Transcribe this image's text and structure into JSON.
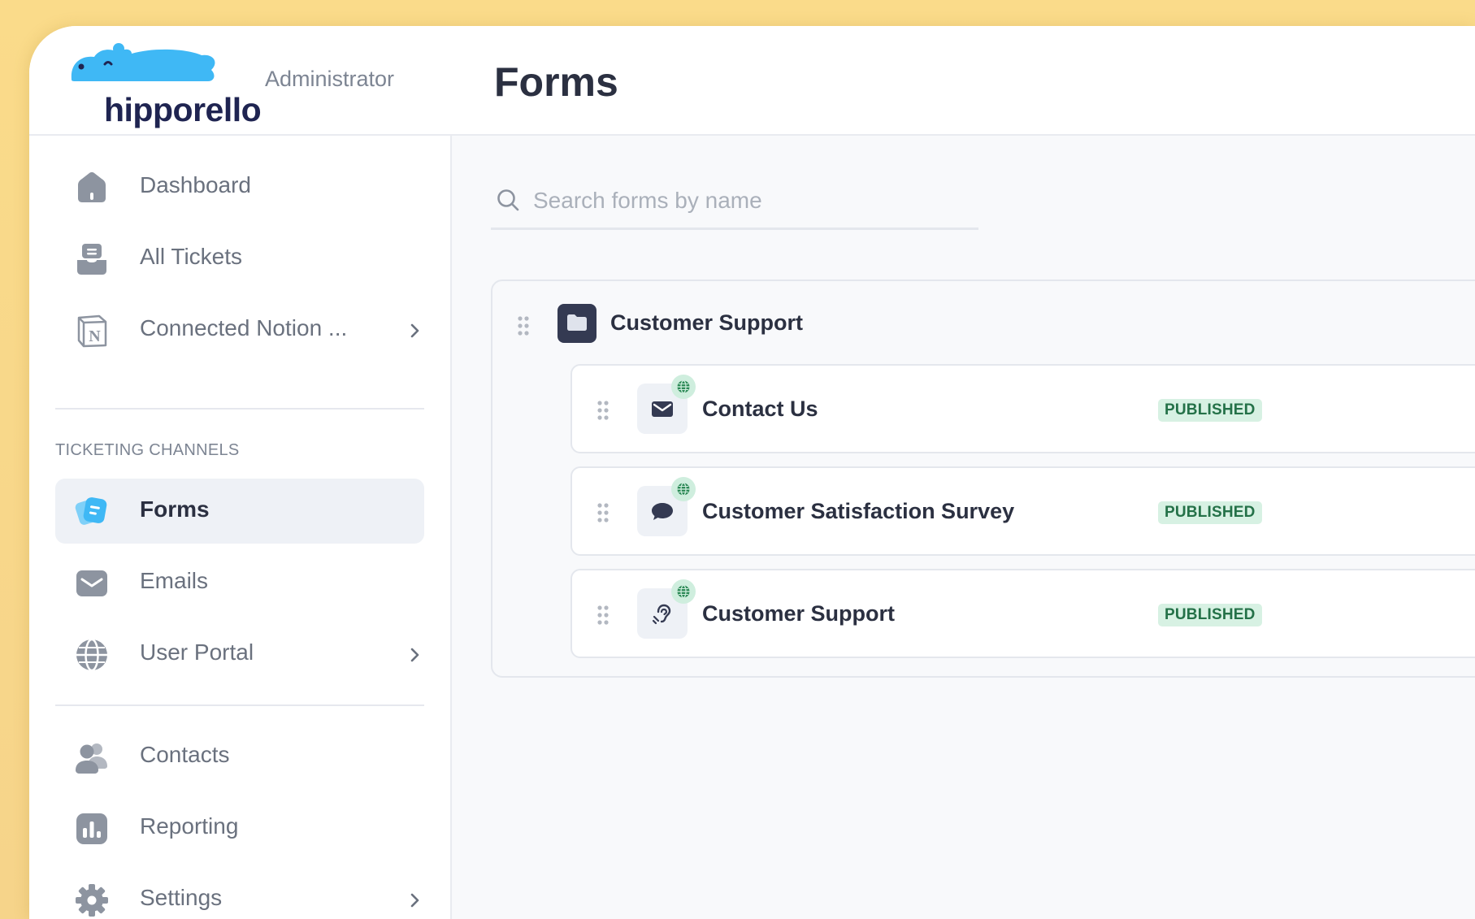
{
  "app": {
    "brand": "hipporello",
    "role": "Administrator",
    "page_title": "Forms"
  },
  "sidebar": {
    "items": [
      {
        "label": "Dashboard",
        "icon": "home-icon"
      },
      {
        "label": "All Tickets",
        "icon": "inbox-icon"
      },
      {
        "label": "Connected Notion ...",
        "icon": "notion-icon",
        "has_submenu": true
      }
    ],
    "section_title": "TICKETING CHANNELS",
    "channels": [
      {
        "label": "Forms",
        "icon": "forms-icon",
        "active": true
      },
      {
        "label": "Emails",
        "icon": "envelope-icon"
      },
      {
        "label": "User Portal",
        "icon": "globe-icon",
        "has_submenu": true
      }
    ],
    "bottom": [
      {
        "label": "Contacts",
        "icon": "users-icon"
      },
      {
        "label": "Reporting",
        "icon": "chart-icon"
      },
      {
        "label": "Settings",
        "icon": "gear-icon",
        "has_submenu": true
      }
    ]
  },
  "search": {
    "placeholder": "Search forms by name",
    "value": ""
  },
  "group": {
    "title": "Customer Support",
    "icon": "folder-icon",
    "forms": [
      {
        "title": "Contact Us",
        "icon": "envelope-icon",
        "status": "PUBLISHED"
      },
      {
        "title": "Customer Satisfaction Survey",
        "icon": "chat-bubble-icon",
        "status": "PUBLISHED"
      },
      {
        "title": "Customer Support",
        "icon": "hearing-icon",
        "status": "PUBLISHED"
      }
    ]
  },
  "colors": {
    "accent": "#3fb8f5",
    "brand_text": "#1f2451",
    "published_bg": "#d7f1e3",
    "published_text": "#247148",
    "background": "#f7d98d"
  }
}
